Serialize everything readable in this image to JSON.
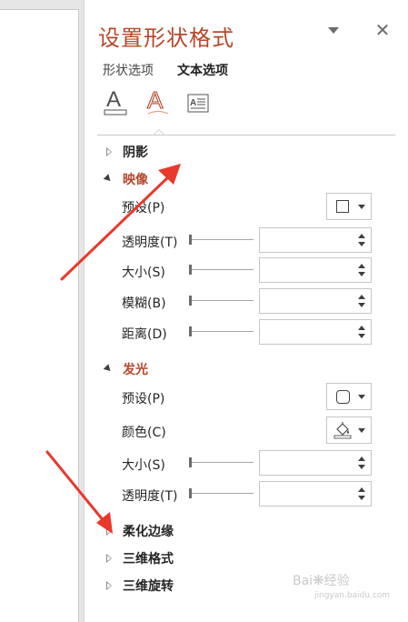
{
  "pane": {
    "title": "设置形状格式",
    "tabs": [
      {
        "label": "形状选项",
        "active": false
      },
      {
        "label": "文本选项",
        "active": true
      }
    ],
    "icon_buttons": [
      "text-fill-outline-icon",
      "text-effects-icon",
      "textbox-icon"
    ]
  },
  "sections": {
    "shadow": {
      "label": "阴影",
      "expanded": false
    },
    "reflection": {
      "label": "映像",
      "expanded": true,
      "preset_label": "预设(P)",
      "transparency_label": "透明度(T)",
      "size_label": "大小(S)",
      "blur_label": "模糊(B)",
      "distance_label": "距离(D)",
      "values": {
        "transparency": "",
        "size": "",
        "blur": "",
        "distance": ""
      }
    },
    "glow": {
      "label": "发光",
      "expanded": true,
      "preset_label": "预设(P)",
      "color_label": "颜色(C)",
      "size_label": "大小(S)",
      "transparency_label": "透明度(T)",
      "values": {
        "size": "",
        "transparency": ""
      }
    },
    "soft_edges": {
      "label": "柔化边缘",
      "expanded": false
    },
    "format_3d": {
      "label": "三维格式",
      "expanded": false
    },
    "rotation_3d": {
      "label": "三维旋转",
      "expanded": false
    }
  },
  "colors": {
    "accent": "#b7472a",
    "annotation_arrow": "#e8392c",
    "divider": "#c8c8c8"
  },
  "watermark": {
    "brand": "Bai",
    "brand_suffix": "经验",
    "url": "jingyan.baidu.com"
  }
}
